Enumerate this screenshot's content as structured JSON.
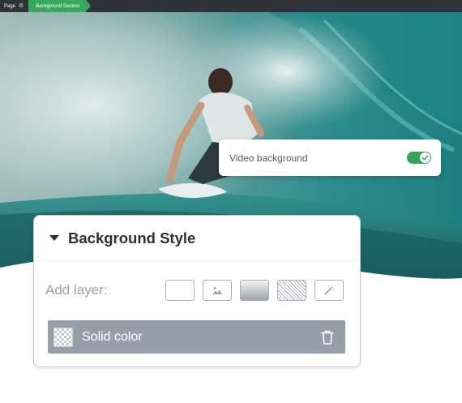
{
  "breadcrumb": {
    "page_label": "Page",
    "section_label": "Background Section"
  },
  "video_card": {
    "label": "Video background",
    "toggle_on": true
  },
  "panel": {
    "title": "Background Style",
    "add_layer_label": "Add layer:",
    "layer_buttons": [
      "solid-color-icon",
      "image-icon",
      "gradient-icon",
      "pattern-icon",
      "magic-wand-icon"
    ],
    "active_layer": {
      "label": "Solid color"
    }
  },
  "colors": {
    "accent_green": "#33a659",
    "breadcrumb_bg": "#2f3338",
    "layer_row_bg": "#969fa9"
  }
}
